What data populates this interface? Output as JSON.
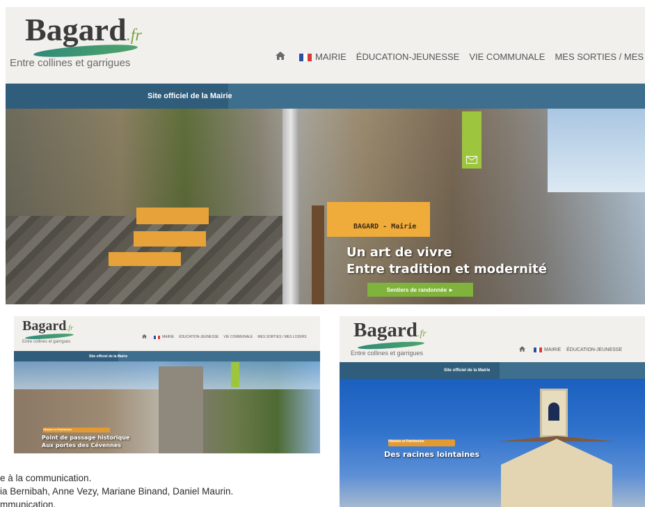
{
  "site": {
    "logo_text": "Bagard",
    "logo_suffix": ".fr",
    "tagline": "Entre collines et garrigues",
    "home_icon": "home-icon",
    "flag_icon": "french-flag-icon",
    "banner": "Site officiel de la Mairie",
    "colors": {
      "banner": "#3e6f8e",
      "accent_green": "#7fb33b",
      "accent_orange": "#e39a33"
    }
  },
  "nav": [
    {
      "label": "MAIRIE"
    },
    {
      "label": "ÉDUCATION-JEUNESSE"
    },
    {
      "label": "VIE COMMUNALE"
    },
    {
      "label": "MES SORTIES / MES LOISIRS"
    }
  ],
  "hero_main": {
    "sign_label": "BAGARD - Mairie",
    "headline_line1": "Un art de vivre",
    "headline_line2": "Entre tradition et modernité",
    "cta_label": "Sentiers de randonnée ►",
    "mail_icon": "envelope-icon"
  },
  "hero_second": {
    "ribbon": "Histoire et Patrimoine",
    "headline_line1": "Point de passage historique",
    "headline_line2": "Aux portes des Cévennes"
  },
  "hero_third": {
    "ribbon": "Histoire et Patrimoine",
    "headline": "Des racines lointaines"
  },
  "caption": {
    "line1": "e à la communication.",
    "line2": "ia Bernibah, Anne Vezy, Mariane Binand, Daniel Maurin.",
    "line3": "mmunication."
  }
}
